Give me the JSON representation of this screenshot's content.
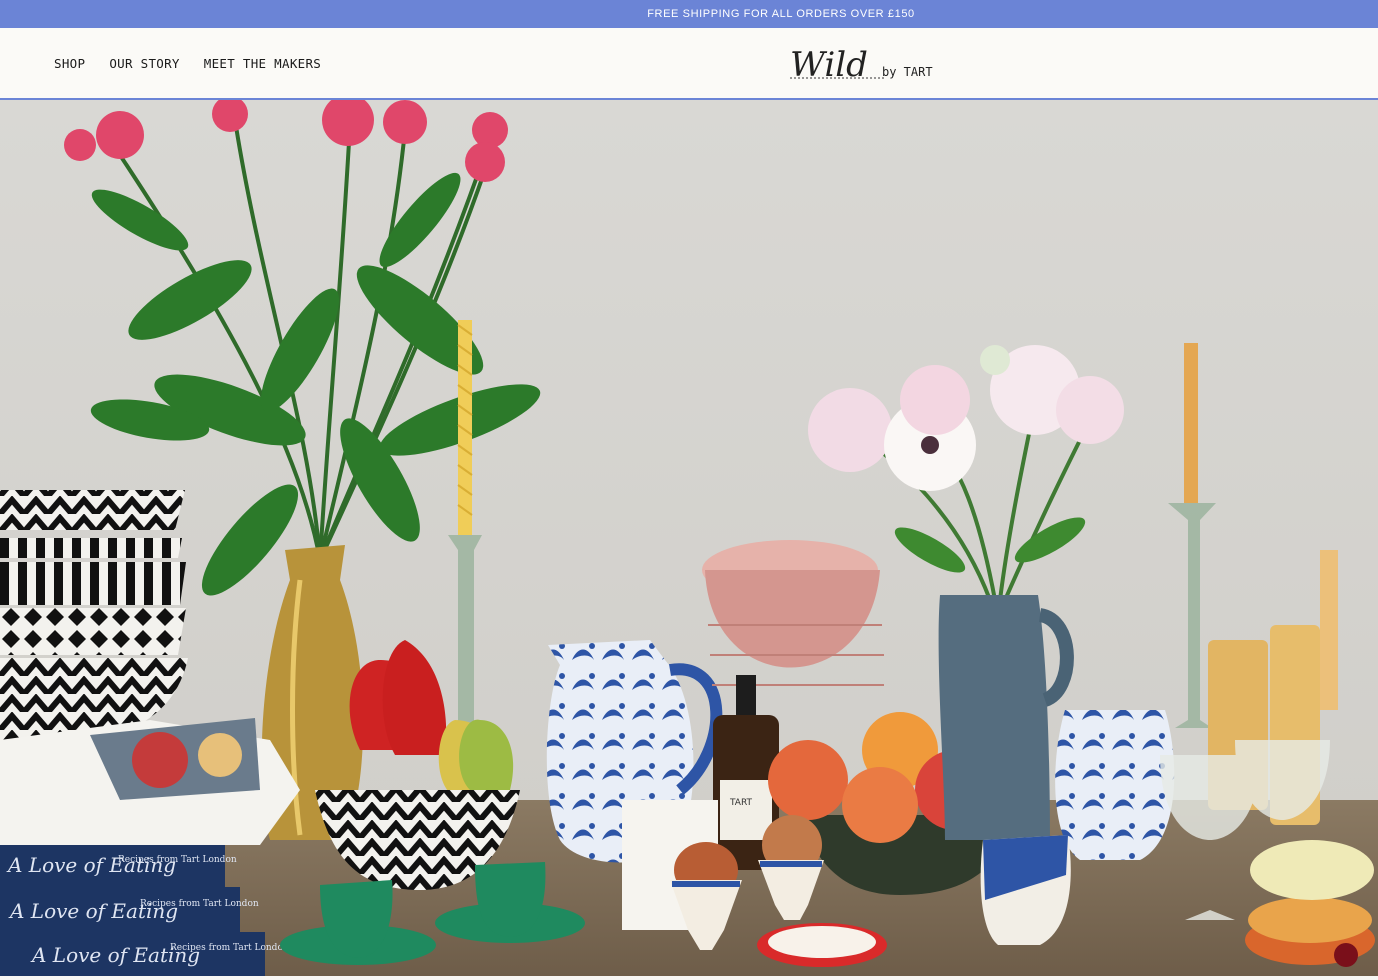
{
  "promo": {
    "text": "FREE SHIPPING FOR ALL ORDERS OVER £150"
  },
  "nav": {
    "items": [
      {
        "label": "SHOP"
      },
      {
        "label": "OUR STORY"
      },
      {
        "label": "MEET THE MAKERS"
      }
    ]
  },
  "logo": {
    "script": "Wild",
    "tail": "by TART"
  },
  "hero": {
    "book_title": "A Love of Eating",
    "book_subtitle": "Recipes from Tart London",
    "bottle_label": "TART"
  },
  "colors": {
    "accent": "#6b84d6",
    "header_bg": "#fbfaf7",
    "wall": "#d6d4cf"
  }
}
